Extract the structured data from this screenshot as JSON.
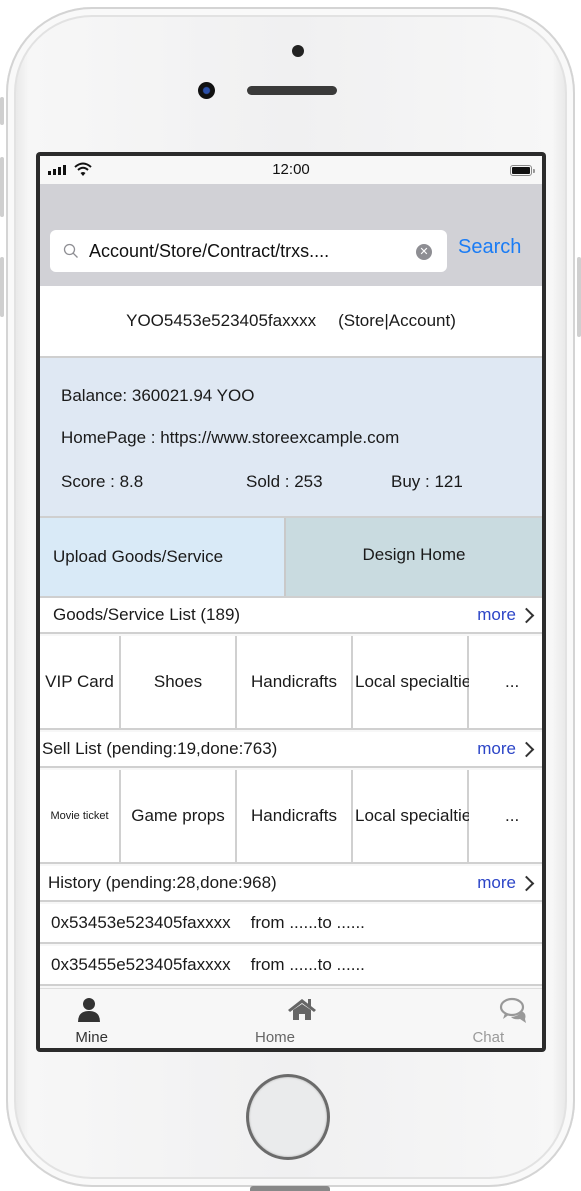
{
  "status_bar": {
    "time": "12:00",
    "signal_icon": "cellular-signal-icon",
    "wifi_icon": "wifi-icon",
    "battery_icon": "battery-icon"
  },
  "search": {
    "value": "Account/Store/Contract/trxs....",
    "search_icon": "search-icon",
    "clear_icon": "clear-icon",
    "button_label": "Search"
  },
  "account": {
    "address": "YOO5453e523405faxxxx",
    "type": "(Store|Account)"
  },
  "info": {
    "balance": "Balance:  360021.94 YOO",
    "homepage": "HomePage  : https://www.storeexcample.com",
    "score": "Score : 8.8",
    "sold": "Sold : 253",
    "buy": "Buy : 121"
  },
  "actions": {
    "upload_label": "Upload Goods/Service",
    "design_label": "Design Home"
  },
  "goods": {
    "title": "Goods/Service List (189)",
    "more_label": "more",
    "items": [
      "VIP Card",
      "Shoes",
      "Handicrafts",
      "Local specialties",
      "..."
    ]
  },
  "sell": {
    "title": "Sell List (pending:19,done:763)",
    "more_label": "more",
    "items": [
      "Movie ticket",
      "Game props",
      "Handicrafts",
      "Local specialties",
      "..."
    ]
  },
  "history": {
    "title": "History (pending:28,done:968)",
    "more_label": "more",
    "rows": [
      {
        "hash": "0x53453e523405faxxxx",
        "route": "from ......to ......"
      },
      {
        "hash": "0x35455e523405faxxxx",
        "route": "from ......to ......"
      }
    ]
  },
  "tabbar": {
    "tabs": [
      {
        "label": "Mine",
        "icon": "user-icon",
        "active": true
      },
      {
        "label": "Home",
        "icon": "home-icon",
        "active": false
      },
      {
        "label": "Chat",
        "icon": "chat-icon",
        "active": false
      }
    ]
  },
  "colors": {
    "accent": "#1a7cf5",
    "more_link": "#2c45c7",
    "info_bg": "#dfe8f3",
    "upload_bg": "#d9eaf7",
    "design_bg": "#c9dbe0"
  }
}
